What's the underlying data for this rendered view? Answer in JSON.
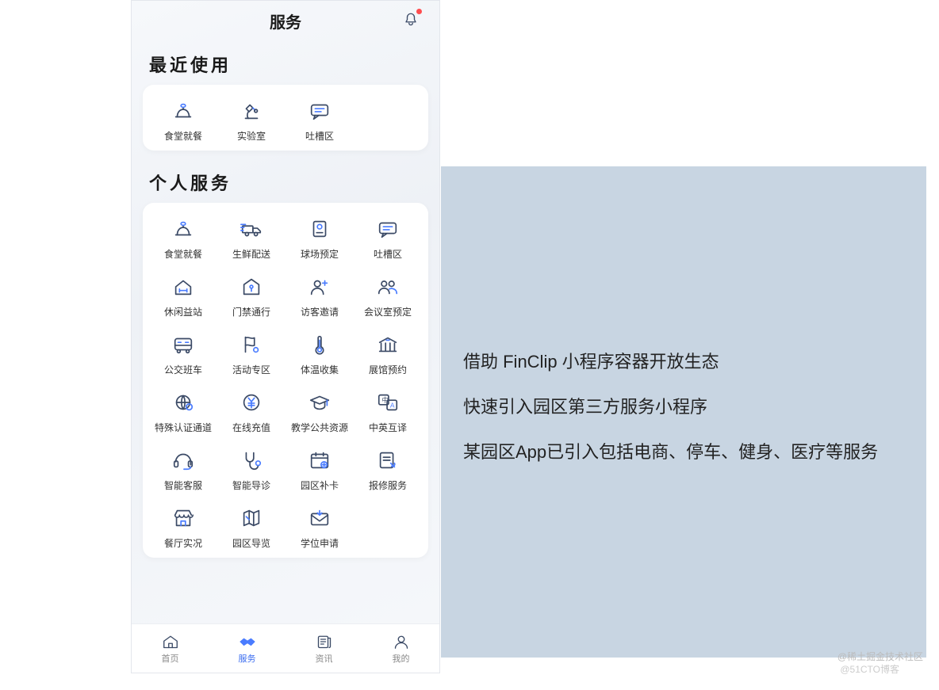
{
  "header": {
    "title": "服务"
  },
  "sections": {
    "recent_title": "最近使用",
    "personal_title": "个人服务"
  },
  "recent": [
    {
      "label": "食堂就餐",
      "icon": "bell-dish"
    },
    {
      "label": "实验室",
      "icon": "microscope"
    },
    {
      "label": "吐槽区",
      "icon": "chat"
    }
  ],
  "personal": [
    {
      "label": "食堂就餐",
      "icon": "bell-dish"
    },
    {
      "label": "生鲜配送",
      "icon": "truck"
    },
    {
      "label": "球场预定",
      "icon": "ticket"
    },
    {
      "label": "吐槽区",
      "icon": "chat"
    },
    {
      "label": "休闲益站",
      "icon": "house-gym"
    },
    {
      "label": "门禁通行",
      "icon": "door-key"
    },
    {
      "label": "访客邀请",
      "icon": "person-plus"
    },
    {
      "label": "会议室预定",
      "icon": "people"
    },
    {
      "label": "公交班车",
      "icon": "bus"
    },
    {
      "label": "活动专区",
      "icon": "flag"
    },
    {
      "label": "体温收集",
      "icon": "thermo"
    },
    {
      "label": "展馆预约",
      "icon": "museum"
    },
    {
      "label": "特殊认证通道",
      "icon": "globe-badge"
    },
    {
      "label": "在线充值",
      "icon": "yen"
    },
    {
      "label": "教学公共资源",
      "icon": "grad-cap"
    },
    {
      "label": "中英互译",
      "icon": "translate"
    },
    {
      "label": "智能客服",
      "icon": "headset"
    },
    {
      "label": "智能导诊",
      "icon": "stethoscope"
    },
    {
      "label": "园区补卡",
      "icon": "calendar-plus"
    },
    {
      "label": "报修服务",
      "icon": "doc-wrench"
    },
    {
      "label": "餐厅实况",
      "icon": "storefront"
    },
    {
      "label": "园区导览",
      "icon": "map"
    },
    {
      "label": "学位申请",
      "icon": "envelope"
    }
  ],
  "tabs": [
    {
      "label": "首页",
      "icon": "home",
      "active": false
    },
    {
      "label": "服务",
      "icon": "handshake",
      "active": true
    },
    {
      "label": "资讯",
      "icon": "news",
      "active": false
    },
    {
      "label": "我的",
      "icon": "user",
      "active": false
    }
  ],
  "side": {
    "line1": "借助 FinClip 小程序容器开放生态",
    "line2": "快速引入园区第三方服务小程序",
    "line3": "某园区App已引入包括电商、停车、健身、医疗等服务"
  },
  "watermarks": {
    "w1": "@稀土掘金技术社区",
    "w2": "@51CTO博客"
  },
  "colors": {
    "accent": "#4a7cff",
    "icon": "#3b4a66",
    "panel": "#c8d5e2"
  }
}
